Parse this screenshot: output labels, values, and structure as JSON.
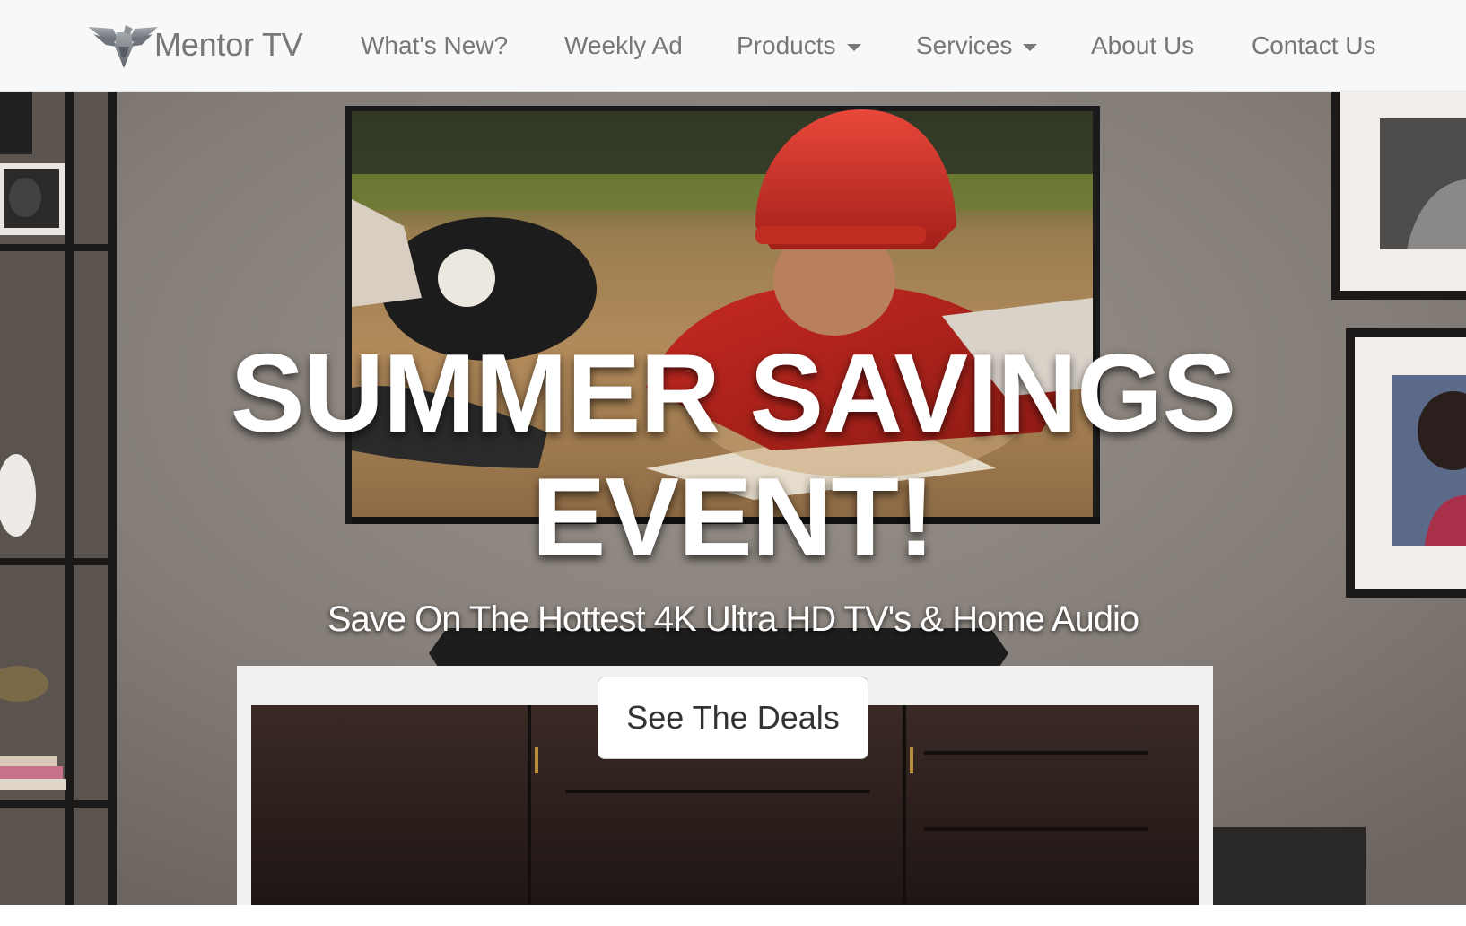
{
  "brand": {
    "name": "Mentor TV",
    "logo_icon": "eagle-icon"
  },
  "nav": {
    "items": [
      {
        "label": "What's New?",
        "has_dropdown": false
      },
      {
        "label": "Weekly Ad",
        "has_dropdown": false
      },
      {
        "label": "Products",
        "has_dropdown": true
      },
      {
        "label": "Services",
        "has_dropdown": true
      },
      {
        "label": "About Us",
        "has_dropdown": false
      },
      {
        "label": "Contact Us",
        "has_dropdown": false
      }
    ]
  },
  "hero": {
    "title_line1": "SUMMER SAVINGS",
    "title_line2": "EVENT!",
    "subtitle": "Save On The Hottest 4K Ultra HD TV's & Home Audio",
    "cta_label": "See The Deals"
  },
  "colors": {
    "navbar_bg": "#f8f8f8",
    "nav_text": "#777777",
    "hero_text": "#ffffff",
    "button_bg": "#ffffff",
    "button_text": "#333333"
  }
}
